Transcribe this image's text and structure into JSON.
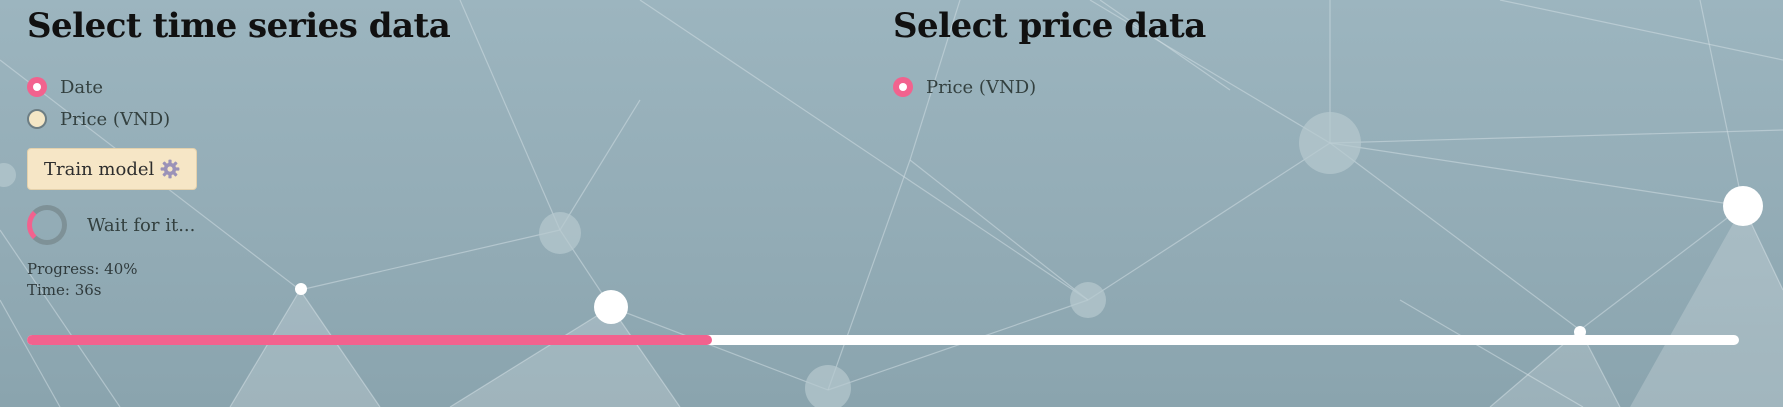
{
  "left_panel": {
    "title": "Select time series data",
    "options": [
      {
        "label": "Date",
        "selected": true
      },
      {
        "label": "Price (VND)",
        "selected": false
      }
    ],
    "train_button": {
      "label": "Train model",
      "icon": "gear-icon"
    },
    "status": {
      "text": "Wait for it...",
      "icon": "spinner-icon"
    },
    "progress_text": "Progress: 40%",
    "time_text": "Time: 36s"
  },
  "right_panel": {
    "title": "Select price data",
    "options": [
      {
        "label": "Price (VND)",
        "selected": true
      }
    ]
  },
  "progress_bar": {
    "value": 0.4
  },
  "colors": {
    "accent": "#f2628e",
    "background": "#9cb5bf",
    "button_bg": "#f6e6c6",
    "track": "#ffffff"
  }
}
